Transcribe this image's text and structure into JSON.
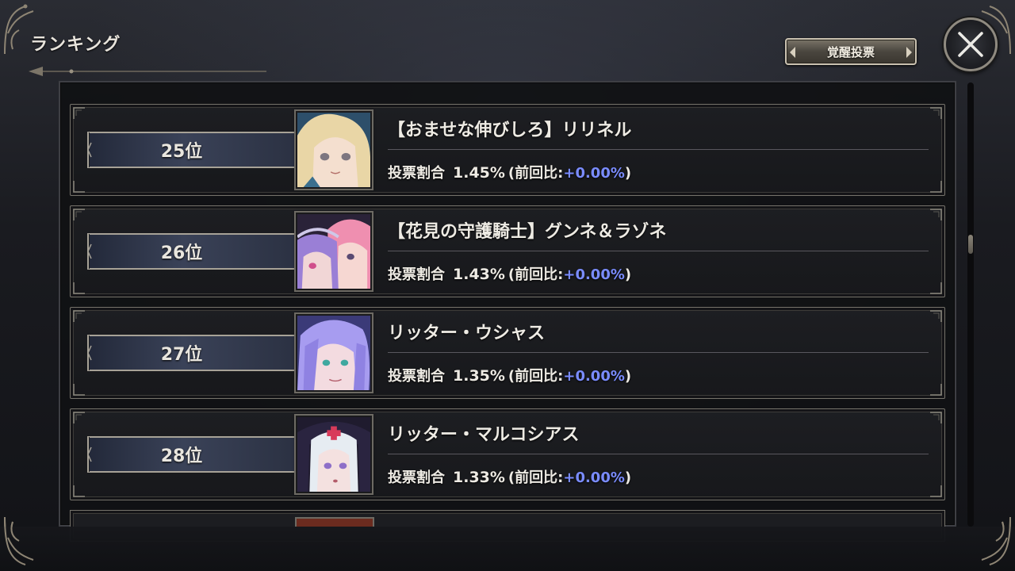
{
  "header": {
    "title": "ランキング",
    "vote_button_label": "覚醒投票"
  },
  "colors": {
    "diff_positive": "#7a8cff",
    "rank_plate": "#3a4258",
    "frame_border": "#76736b"
  },
  "rankings": [
    {
      "rank": "25位",
      "name": "【おませな伸びしろ】リリネル",
      "ratio_label": "投票割合",
      "ratio": "1.45%",
      "prev_prefix": "(前回比:",
      "prev_diff": "+0.00%",
      "prev_suffix": ")",
      "portrait_icon": "character-portrait-blonde-hair"
    },
    {
      "rank": "26位",
      "name": "【花見の守護騎士】グンネ＆ラゾネ",
      "ratio_label": "投票割合",
      "ratio": "1.43%",
      "prev_prefix": "(前回比:",
      "prev_diff": "+0.00%",
      "prev_suffix": ")",
      "portrait_icon": "character-portrait-pink-hair-duo"
    },
    {
      "rank": "27位",
      "name": "リッター・ウシャス",
      "ratio_label": "投票割合",
      "ratio": "1.35%",
      "prev_prefix": "(前回比:",
      "prev_diff": "+0.00%",
      "prev_suffix": ")",
      "portrait_icon": "character-portrait-purple-hair"
    },
    {
      "rank": "28位",
      "name": "リッター・マルコシアス",
      "ratio_label": "投票割合",
      "ratio": "1.33%",
      "prev_prefix": "(前回比:",
      "prev_diff": "+0.00%",
      "prev_suffix": ")",
      "portrait_icon": "character-portrait-white-hair-nun"
    }
  ]
}
